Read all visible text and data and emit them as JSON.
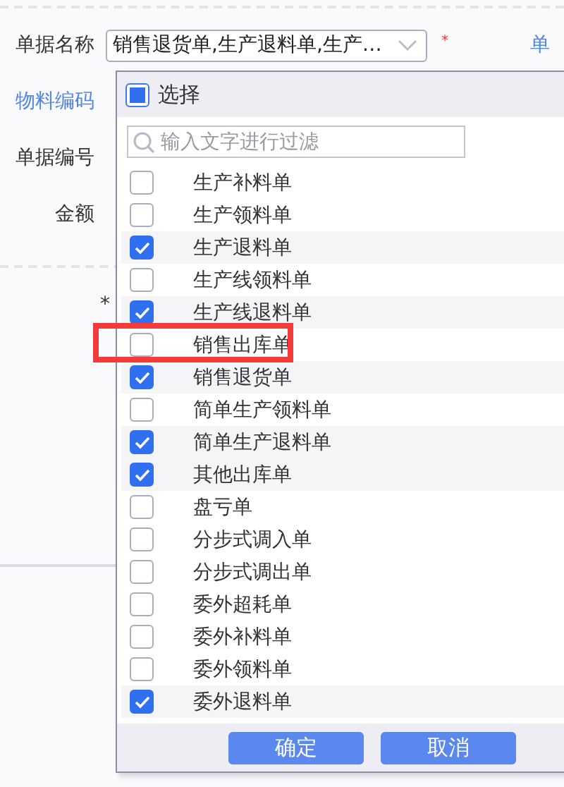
{
  "form": {
    "fields": [
      {
        "label": "单据名称",
        "kind": "select",
        "value": "销售退货单,生产退料单,生产…",
        "required_mark": "*",
        "link": "单"
      },
      {
        "label": "物料编码",
        "kind": "link"
      },
      {
        "label": "单据编号",
        "kind": "plain"
      },
      {
        "label": "金额",
        "kind": "plain"
      }
    ],
    "asterisk": "*"
  },
  "dropdown": {
    "select_all": {
      "label": "选择",
      "partial": true
    },
    "filter": {
      "placeholder": "输入文字进行过滤"
    },
    "items": [
      {
        "label": "生产补料单",
        "checked": false
      },
      {
        "label": "生产领料单",
        "checked": false
      },
      {
        "label": "生产退料单",
        "checked": true
      },
      {
        "label": "生产线领料单",
        "checked": false
      },
      {
        "label": "生产线退料单",
        "checked": true
      },
      {
        "label": "销售出库单",
        "checked": false,
        "highlighted": true
      },
      {
        "label": "销售退货单",
        "checked": true
      },
      {
        "label": "简单生产领料单",
        "checked": false
      },
      {
        "label": "简单生产退料单",
        "checked": true
      },
      {
        "label": "其他出库单",
        "checked": true
      },
      {
        "label": "盘亏单",
        "checked": false
      },
      {
        "label": "分步式调入单",
        "checked": false
      },
      {
        "label": "分步式调出单",
        "checked": false
      },
      {
        "label": "委外超耗单",
        "checked": false
      },
      {
        "label": "委外补料单",
        "checked": false
      },
      {
        "label": "委外领料单",
        "checked": false
      },
      {
        "label": "委外退料单",
        "checked": true
      }
    ],
    "buttons": [
      "确定",
      "取消"
    ]
  }
}
